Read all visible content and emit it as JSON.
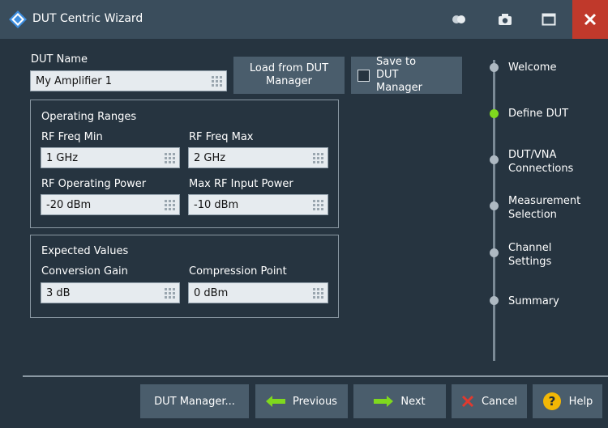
{
  "window": {
    "title": "DUT Centric Wizard"
  },
  "dut": {
    "name_label": "DUT Name",
    "name_value": "My Amplifier 1",
    "load_button": "Load from DUT Manager",
    "save_checkbox_label": "Save to DUT Manager",
    "save_checked": false
  },
  "operating_ranges": {
    "title": "Operating Ranges",
    "rf_freq_min_label": "RF Freq Min",
    "rf_freq_min_value": "1 GHz",
    "rf_freq_max_label": "RF Freq Max",
    "rf_freq_max_value": "2 GHz",
    "rf_power_label": "RF Operating Power",
    "rf_power_value": "-20 dBm",
    "max_input_label": "Max RF Input Power",
    "max_input_value": "-10 dBm"
  },
  "expected_values": {
    "title": "Expected Values",
    "gain_label": "Conversion Gain",
    "gain_value": "3 dB",
    "compression_label": "Compression Point",
    "compression_value": "0 dBm"
  },
  "steps": [
    {
      "label": "Welcome",
      "active": false
    },
    {
      "label": "Define DUT",
      "active": true
    },
    {
      "label": "DUT/VNA Connections",
      "active": false
    },
    {
      "label": "Measurement Selection",
      "active": false
    },
    {
      "label": "Channel Settings",
      "active": false
    },
    {
      "label": "Summary",
      "active": false
    }
  ],
  "footer": {
    "dut_manager": "DUT Manager...",
    "previous": "Previous",
    "next": "Next",
    "cancel": "Cancel",
    "help": "Help"
  },
  "colors": {
    "background": "#263440",
    "titlebar": "#3a4d5c",
    "button": "#4a5d6c",
    "close": "#c0392b",
    "active_step": "#7fd81e",
    "arrow": "#7fd81e",
    "cancel_x": "#e03a2f",
    "help": "#f2b705"
  },
  "icons": {
    "logo": "rohde-schwarz-logo",
    "toggle": "toggle-icon",
    "camera": "camera-icon",
    "maximize": "maximize-icon",
    "close": "close-icon",
    "keypad": "keypad-icon",
    "previous": "arrow-left-icon",
    "next": "arrow-right-icon",
    "cancel": "cancel-x-icon",
    "help": "help-icon"
  }
}
